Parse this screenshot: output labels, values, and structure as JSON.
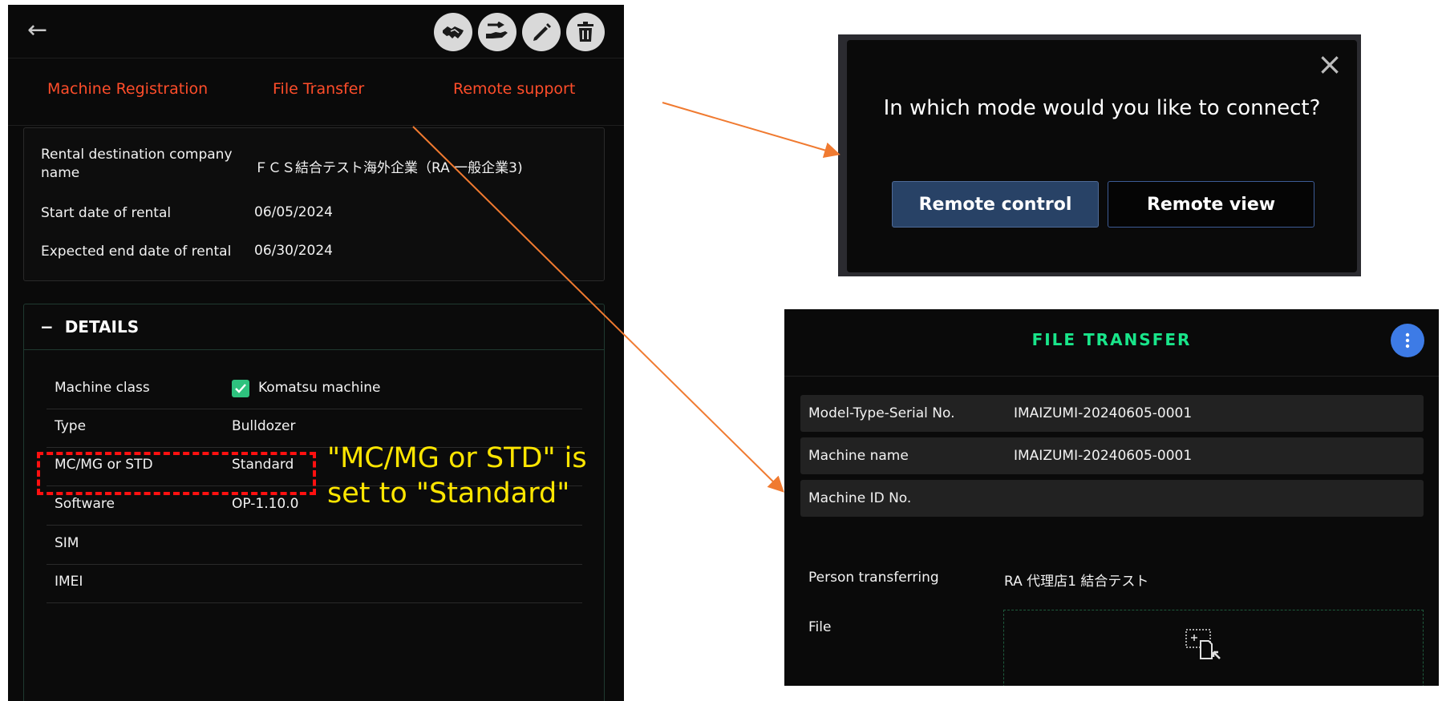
{
  "left_panel": {
    "header": {
      "back_icon": "arrow-left",
      "back_glyph": "←"
    },
    "actions": [
      {
        "name": "handshake-icon"
      },
      {
        "name": "hand-transfer-icon"
      },
      {
        "name": "pencil-icon"
      },
      {
        "name": "trash-icon"
      }
    ],
    "tabs": {
      "machine_registration": "Machine Registration",
      "file_transfer": "File Transfer",
      "remote_support": "Remote support"
    },
    "rental": {
      "company_label": "Rental destination company name",
      "company_value": "ＦＣＳ結合テスト海外企業（RA 一般企業3)",
      "start_label": "Start date of rental",
      "start_value": "06/05/2024",
      "end_label": "Expected end date of rental",
      "end_value": "06/30/2024"
    },
    "details": {
      "collapse_glyph": "−",
      "title": "DETAILS",
      "rows": {
        "machine_class": {
          "label": "Machine class",
          "value": "Komatsu machine",
          "checked": true
        },
        "type": {
          "label": "Type",
          "value": "Bulldozer"
        },
        "mc_mg": {
          "label": "MC/MG or STD",
          "value": "Standard"
        },
        "software": {
          "label": "Software",
          "value": "OP-1.10.0"
        },
        "sim": {
          "label": "SIM",
          "value": ""
        },
        "imei": {
          "label": "IMEI",
          "value": ""
        }
      }
    }
  },
  "annotation": {
    "text": "\"MC/MG or STD\" is set to \"Standard\"",
    "color": "#ffe600",
    "highlight_color": "#ff1010"
  },
  "remote_dialog": {
    "close_glyph": "×",
    "question": "In which mode would you like to connect?",
    "remote_control": "Remote control",
    "remote_view": "Remote view"
  },
  "file_transfer": {
    "title": "FILE TRANSFER",
    "menu_icon": "kebab-menu-icon",
    "model_label": "Model-Type-Serial No.",
    "model_value": "IMAIZUMI-20240605-0001",
    "machine_name_label": "Machine name",
    "machine_name_value": "IMAIZUMI-20240605-0001",
    "machine_id_label": "Machine ID No.",
    "machine_id_value": "",
    "person_label": "Person transferring",
    "person_value": "RA 代理店1 結合テスト",
    "file_label": "File",
    "upload_icon": "file-drop-icon"
  },
  "colors": {
    "tab_orange": "#ff4d2a",
    "accent_green": "#19e58a",
    "arrow_orange": "#f07a30",
    "menu_blue": "#3d7be6"
  }
}
